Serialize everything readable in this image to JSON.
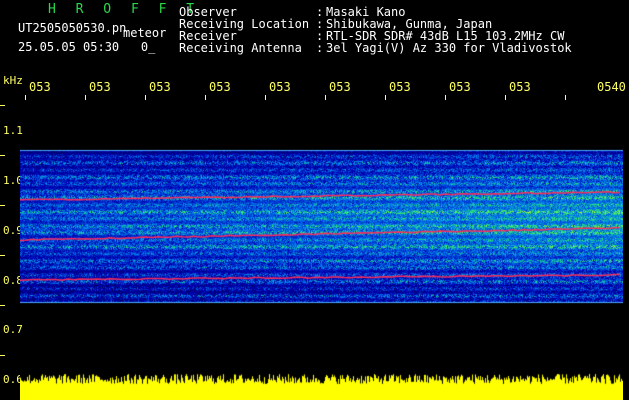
{
  "header": {
    "brand": "H R O F F T",
    "filename": "UT2505050530.pn",
    "event": "meteor",
    "timestamp_date": "25.05.05 05:30",
    "timestamp_suffix": "0_",
    "meta": [
      {
        "label": "Observer",
        "value": "Masaki Kano"
      },
      {
        "label": "Receiving Location",
        "value": "Shibukawa, Gunma, Japan"
      },
      {
        "label": "Receiver",
        "value": "RTL-SDR SDR# 43dB L15 103.2MHz CW"
      },
      {
        "label": "Receiving Antenna",
        "value": "3el Yagi(V) Az 330 for Vladivostok"
      }
    ]
  },
  "axis": {
    "unit": "kHz",
    "time_ticks": [
      "053",
      "053",
      "053",
      "053",
      "053",
      "053",
      "053",
      "053",
      "053",
      "0540"
    ],
    "freq_ticks": [
      "1.1",
      "1.0",
      "0.9",
      "0.8",
      "0.7",
      "0.6"
    ]
  },
  "colors": {
    "background": "#000000",
    "axis": "#ffff66",
    "brand": "#2bd84a",
    "power_trace": "#ffff00",
    "echo_line": "#ff2b5a"
  },
  "spectrogram": {
    "echo_line_freqs_khz": [
      0.96,
      0.88,
      0.8
    ]
  }
}
